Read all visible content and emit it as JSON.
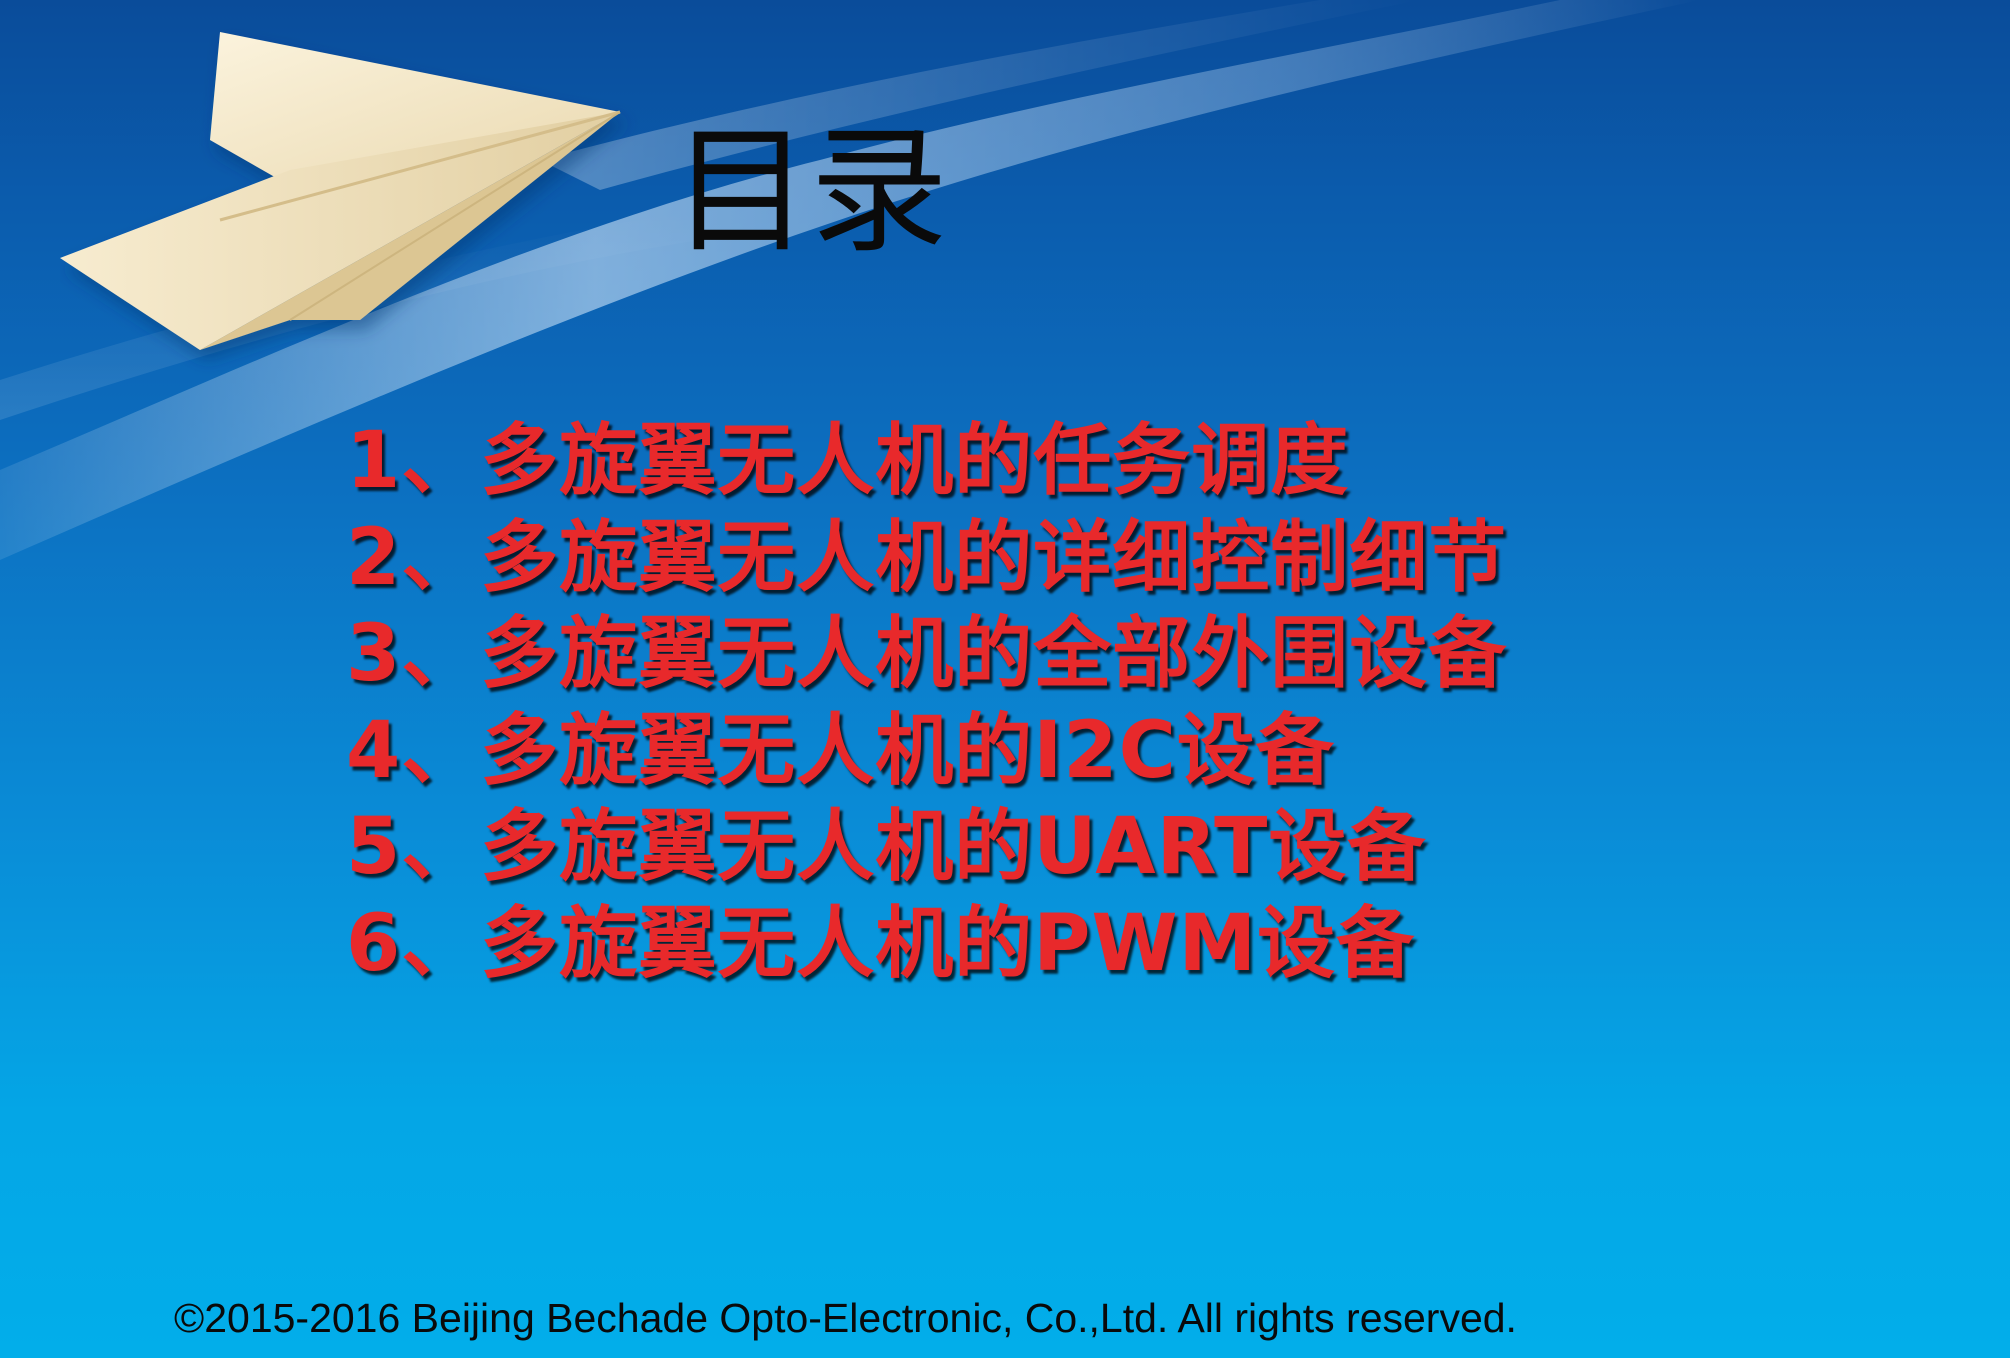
{
  "slide": {
    "title": "目录",
    "items": [
      "1、多旋翼无人机的任务调度",
      "2、多旋翼无人机的详细控制细节",
      "3、多旋翼无人机的全部外围设备",
      "4、多旋翼无人机的I2C设备",
      "5、多旋翼无人机的UART设备",
      "6、多旋翼无人机的PWM设备"
    ],
    "footer": "©2015-2016 Beijing Bechade Opto-Electronic, Co.,Ltd. All rights reserved."
  },
  "colors": {
    "background_top": "#0a4c9a",
    "background_bottom": "#02aeea",
    "title": "#0a0a0a",
    "items": "#e8292b",
    "footer": "#0a0a0a",
    "paper_plane": "#f6ebcf"
  },
  "decorations": [
    "paper-plane-graphic",
    "light-sweep"
  ]
}
